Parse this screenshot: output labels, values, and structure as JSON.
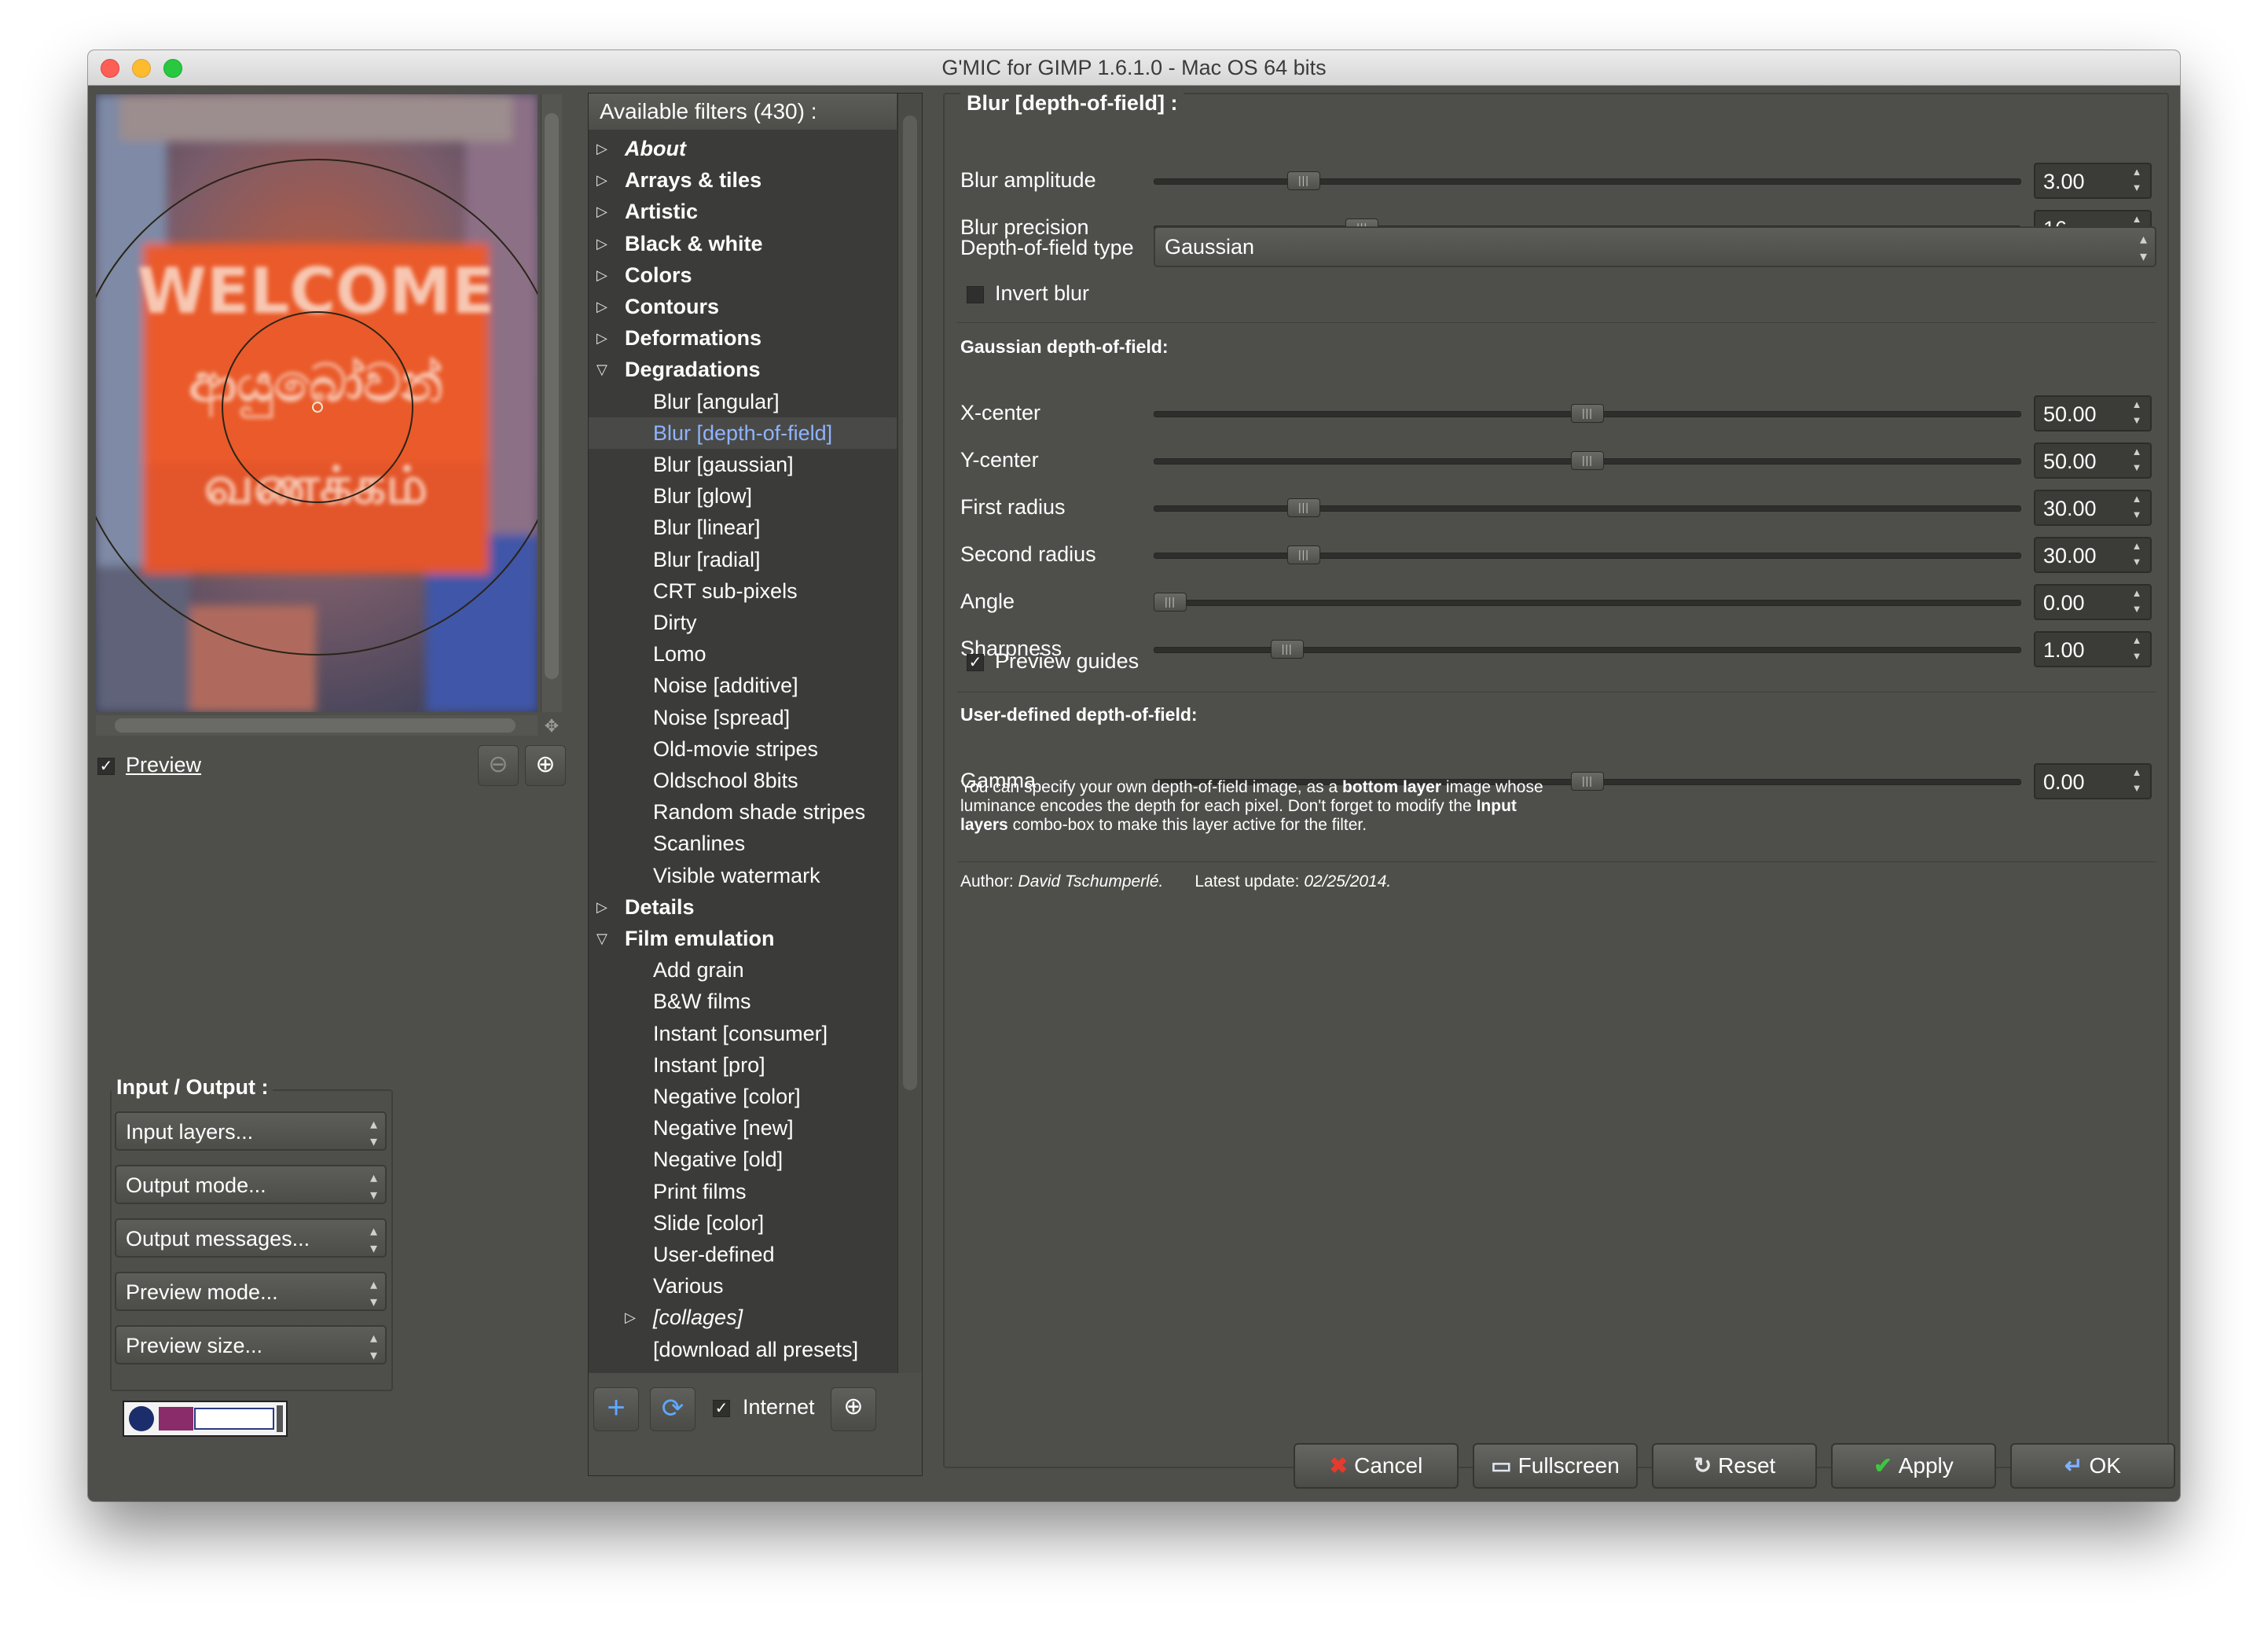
{
  "window": {
    "title": "G'MIC for GIMP 1.6.1.0 - Mac OS 64 bits"
  },
  "preview": {
    "sign_line1": "WELCOME",
    "sign_line2": "ආයුබෝවන්",
    "sign_line3": "வணக்கம்",
    "preview_label": "Preview",
    "preview_checked": true
  },
  "io": {
    "title": "Input / Output :",
    "combos": [
      "Input layers...",
      "Output mode...",
      "Output messages...",
      "Preview mode...",
      "Preview size..."
    ]
  },
  "filters": {
    "header": "Available filters (430) :",
    "items": [
      {
        "label": "About",
        "kind": "collapsed",
        "italic": true
      },
      {
        "label": "Arrays & tiles",
        "kind": "collapsed"
      },
      {
        "label": "Artistic",
        "kind": "collapsed"
      },
      {
        "label": "Black & white",
        "kind": "collapsed"
      },
      {
        "label": "Colors",
        "kind": "collapsed"
      },
      {
        "label": "Contours",
        "kind": "collapsed"
      },
      {
        "label": "Deformations",
        "kind": "collapsed"
      },
      {
        "label": "Degradations",
        "kind": "expanded"
      },
      {
        "label": "Blur [angular]",
        "kind": "leaf"
      },
      {
        "label": "Blur [depth-of-field]",
        "kind": "leaf",
        "selected": true
      },
      {
        "label": "Blur [gaussian]",
        "kind": "leaf"
      },
      {
        "label": "Blur [glow]",
        "kind": "leaf"
      },
      {
        "label": "Blur [linear]",
        "kind": "leaf"
      },
      {
        "label": "Blur [radial]",
        "kind": "leaf"
      },
      {
        "label": "CRT sub-pixels",
        "kind": "leaf"
      },
      {
        "label": "Dirty",
        "kind": "leaf"
      },
      {
        "label": "Lomo",
        "kind": "leaf"
      },
      {
        "label": "Noise [additive]",
        "kind": "leaf"
      },
      {
        "label": "Noise [spread]",
        "kind": "leaf"
      },
      {
        "label": "Old-movie stripes",
        "kind": "leaf"
      },
      {
        "label": "Oldschool 8bits",
        "kind": "leaf"
      },
      {
        "label": "Random shade stripes",
        "kind": "leaf"
      },
      {
        "label": "Scanlines",
        "kind": "leaf"
      },
      {
        "label": "Visible watermark",
        "kind": "leaf"
      },
      {
        "label": "Details",
        "kind": "collapsed"
      },
      {
        "label": "Film emulation",
        "kind": "expanded"
      },
      {
        "label": "Add grain",
        "kind": "leaf"
      },
      {
        "label": "B&W films",
        "kind": "leaf"
      },
      {
        "label": "Instant [consumer]",
        "kind": "leaf"
      },
      {
        "label": "Instant [pro]",
        "kind": "leaf"
      },
      {
        "label": "Negative [color]",
        "kind": "leaf"
      },
      {
        "label": "Negative [new]",
        "kind": "leaf"
      },
      {
        "label": "Negative [old]",
        "kind": "leaf"
      },
      {
        "label": "Print films",
        "kind": "leaf"
      },
      {
        "label": "Slide [color]",
        "kind": "leaf"
      },
      {
        "label": "User-defined",
        "kind": "leaf"
      },
      {
        "label": "Various",
        "kind": "leaf"
      },
      {
        "label": "[collages]",
        "kind": "subcollapsed",
        "italic": true
      },
      {
        "label": "[download all presets]",
        "kind": "leaf"
      }
    ],
    "internet_label": "Internet",
    "internet_checked": true
  },
  "filter_panel": {
    "title": "Blur [depth-of-field] :",
    "blur_amplitude": {
      "label": "Blur amplitude",
      "value": "3.00",
      "fraction": 0.16
    },
    "blur_precision": {
      "label": "Blur precision",
      "value": "16",
      "fraction": 0.23
    },
    "dof_type": {
      "label": "Depth-of-field type",
      "value": "Gaussian"
    },
    "invert_blur": {
      "label": "Invert blur",
      "checked": false
    },
    "gaussian_title": "Gaussian depth-of-field:",
    "x_center": {
      "label": "X-center",
      "value": "50.00",
      "fraction": 0.5
    },
    "y_center": {
      "label": "Y-center",
      "value": "50.00",
      "fraction": 0.5
    },
    "first_radius": {
      "label": "First radius",
      "value": "30.00",
      "fraction": 0.16
    },
    "second_radius": {
      "label": "Second radius",
      "value": "30.00",
      "fraction": 0.16
    },
    "angle": {
      "label": "Angle",
      "value": "0.00",
      "fraction": 0.0
    },
    "sharpness": {
      "label": "Sharpness",
      "value": "1.00",
      "fraction": 0.14
    },
    "preview_guides": {
      "label": "Preview guides",
      "checked": true
    },
    "user_title": "User-defined depth-of-field:",
    "gamma": {
      "label": "Gamma",
      "value": "0.00",
      "fraction": 0.5
    },
    "note_part1": "You can specify your own depth-of-field image, as a ",
    "note_bold1": "bottom layer",
    "note_part2": "image whose luminance encodes the depth for each pixel. Don't forget to modify the ",
    "note_bold2": "Input layers",
    "note_part3": " combo-box to make this layer active for the filter.",
    "author_label": "Author: ",
    "author_name": "David Tschumperlé.",
    "update_label": "Latest update: ",
    "update_date": "02/25/2014."
  },
  "buttons": {
    "cancel": "Cancel",
    "fullscreen": "Fullscreen",
    "reset": "Reset",
    "apply": "Apply",
    "ok": "OK"
  },
  "colors": {
    "window_bg": "#4e4f4b",
    "tree_bg": "#3b3c3a",
    "selected_text": "#8fb3ff",
    "sign_orange": "#e8582a"
  }
}
